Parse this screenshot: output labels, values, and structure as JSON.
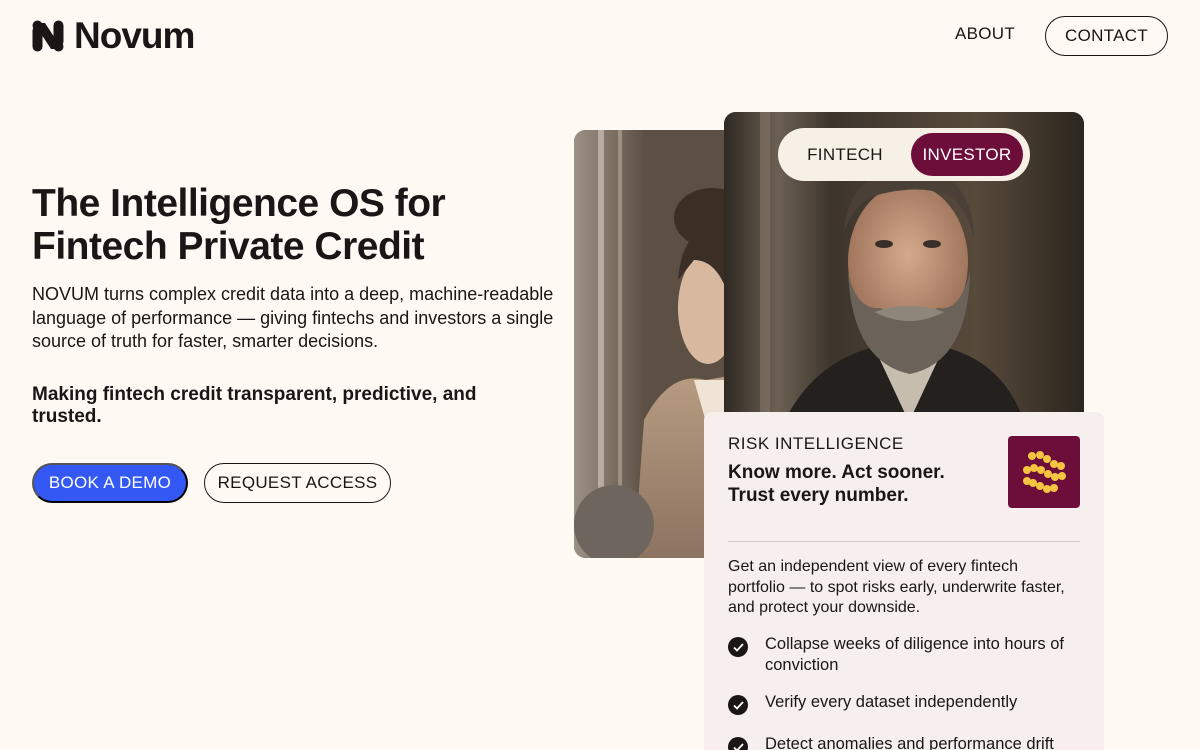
{
  "header": {
    "logo_text": "Novum",
    "nav_about": "ABOUT",
    "nav_contact": "CONTACT"
  },
  "hero": {
    "title": "The Intelligence OS for Fintech Private Credit",
    "description": "NOVUM turns complex credit data into a deep, machine-readable language of performance — giving fintechs and investors a single source of truth for faster, smarter decisions.",
    "tagline": "Making fintech credit transparent, predictive, and trusted.",
    "primary_button": "BOOK A DEMO",
    "secondary_button": "REQUEST ACCESS"
  },
  "toggle": {
    "options": [
      "FINTECH",
      "INVESTOR"
    ],
    "selected": "INVESTOR"
  },
  "card": {
    "label": "RISK INTELLIGENCE",
    "headline": "Know more. Act sooner. Trust every number.",
    "description": "Get an independent view of every fintech portfolio — to spot risks early, underwrite faster, and protect your downside.",
    "features": [
      "Collapse weeks of diligence into hours of conviction",
      "Verify every dataset independently",
      "Detect anomalies and performance drift"
    ]
  },
  "colors": {
    "background": "#fef9f3",
    "primary_blue": "#3358f4",
    "accent_maroon": "#6c0d3a",
    "badge_icon": "#f5c542",
    "card_background": "#f7eeee",
    "text": "#1b1615"
  },
  "icons": {
    "logo": "novum-n-logo-icon",
    "card_badge": "dotted-wave-icon",
    "feature_bullet": "check-circle-icon"
  }
}
